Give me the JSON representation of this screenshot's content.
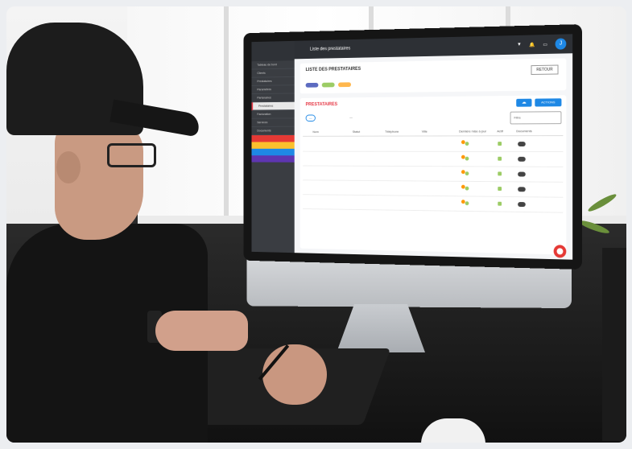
{
  "app": {
    "topbar_title": "Liste des prestataires",
    "avatar_initial": "J"
  },
  "sidebar": {
    "items": [
      "Tableau de bord",
      "Clients",
      "Prestataires",
      "Paramètres",
      "Partenaires",
      "Prestataires",
      "Facturation",
      "Services",
      "Documents"
    ]
  },
  "panel": {
    "heading": "LISTE DES PRESTATAIRES",
    "back_button": "RETOUR"
  },
  "list": {
    "title": "PRESTATAIRES",
    "actions_button": "ACTIONS",
    "search_placeholder": "Filtre",
    "columns": [
      "Nom",
      "Statut",
      "Téléphone",
      "Ville",
      "Dernière mise à jour",
      "Actif",
      "Documents"
    ]
  },
  "colors": {
    "accent": "#1e88e5",
    "brand_red": "#e63946",
    "sidebar_bg": "#3a3d42",
    "topbar_bg": "#2d3035"
  }
}
